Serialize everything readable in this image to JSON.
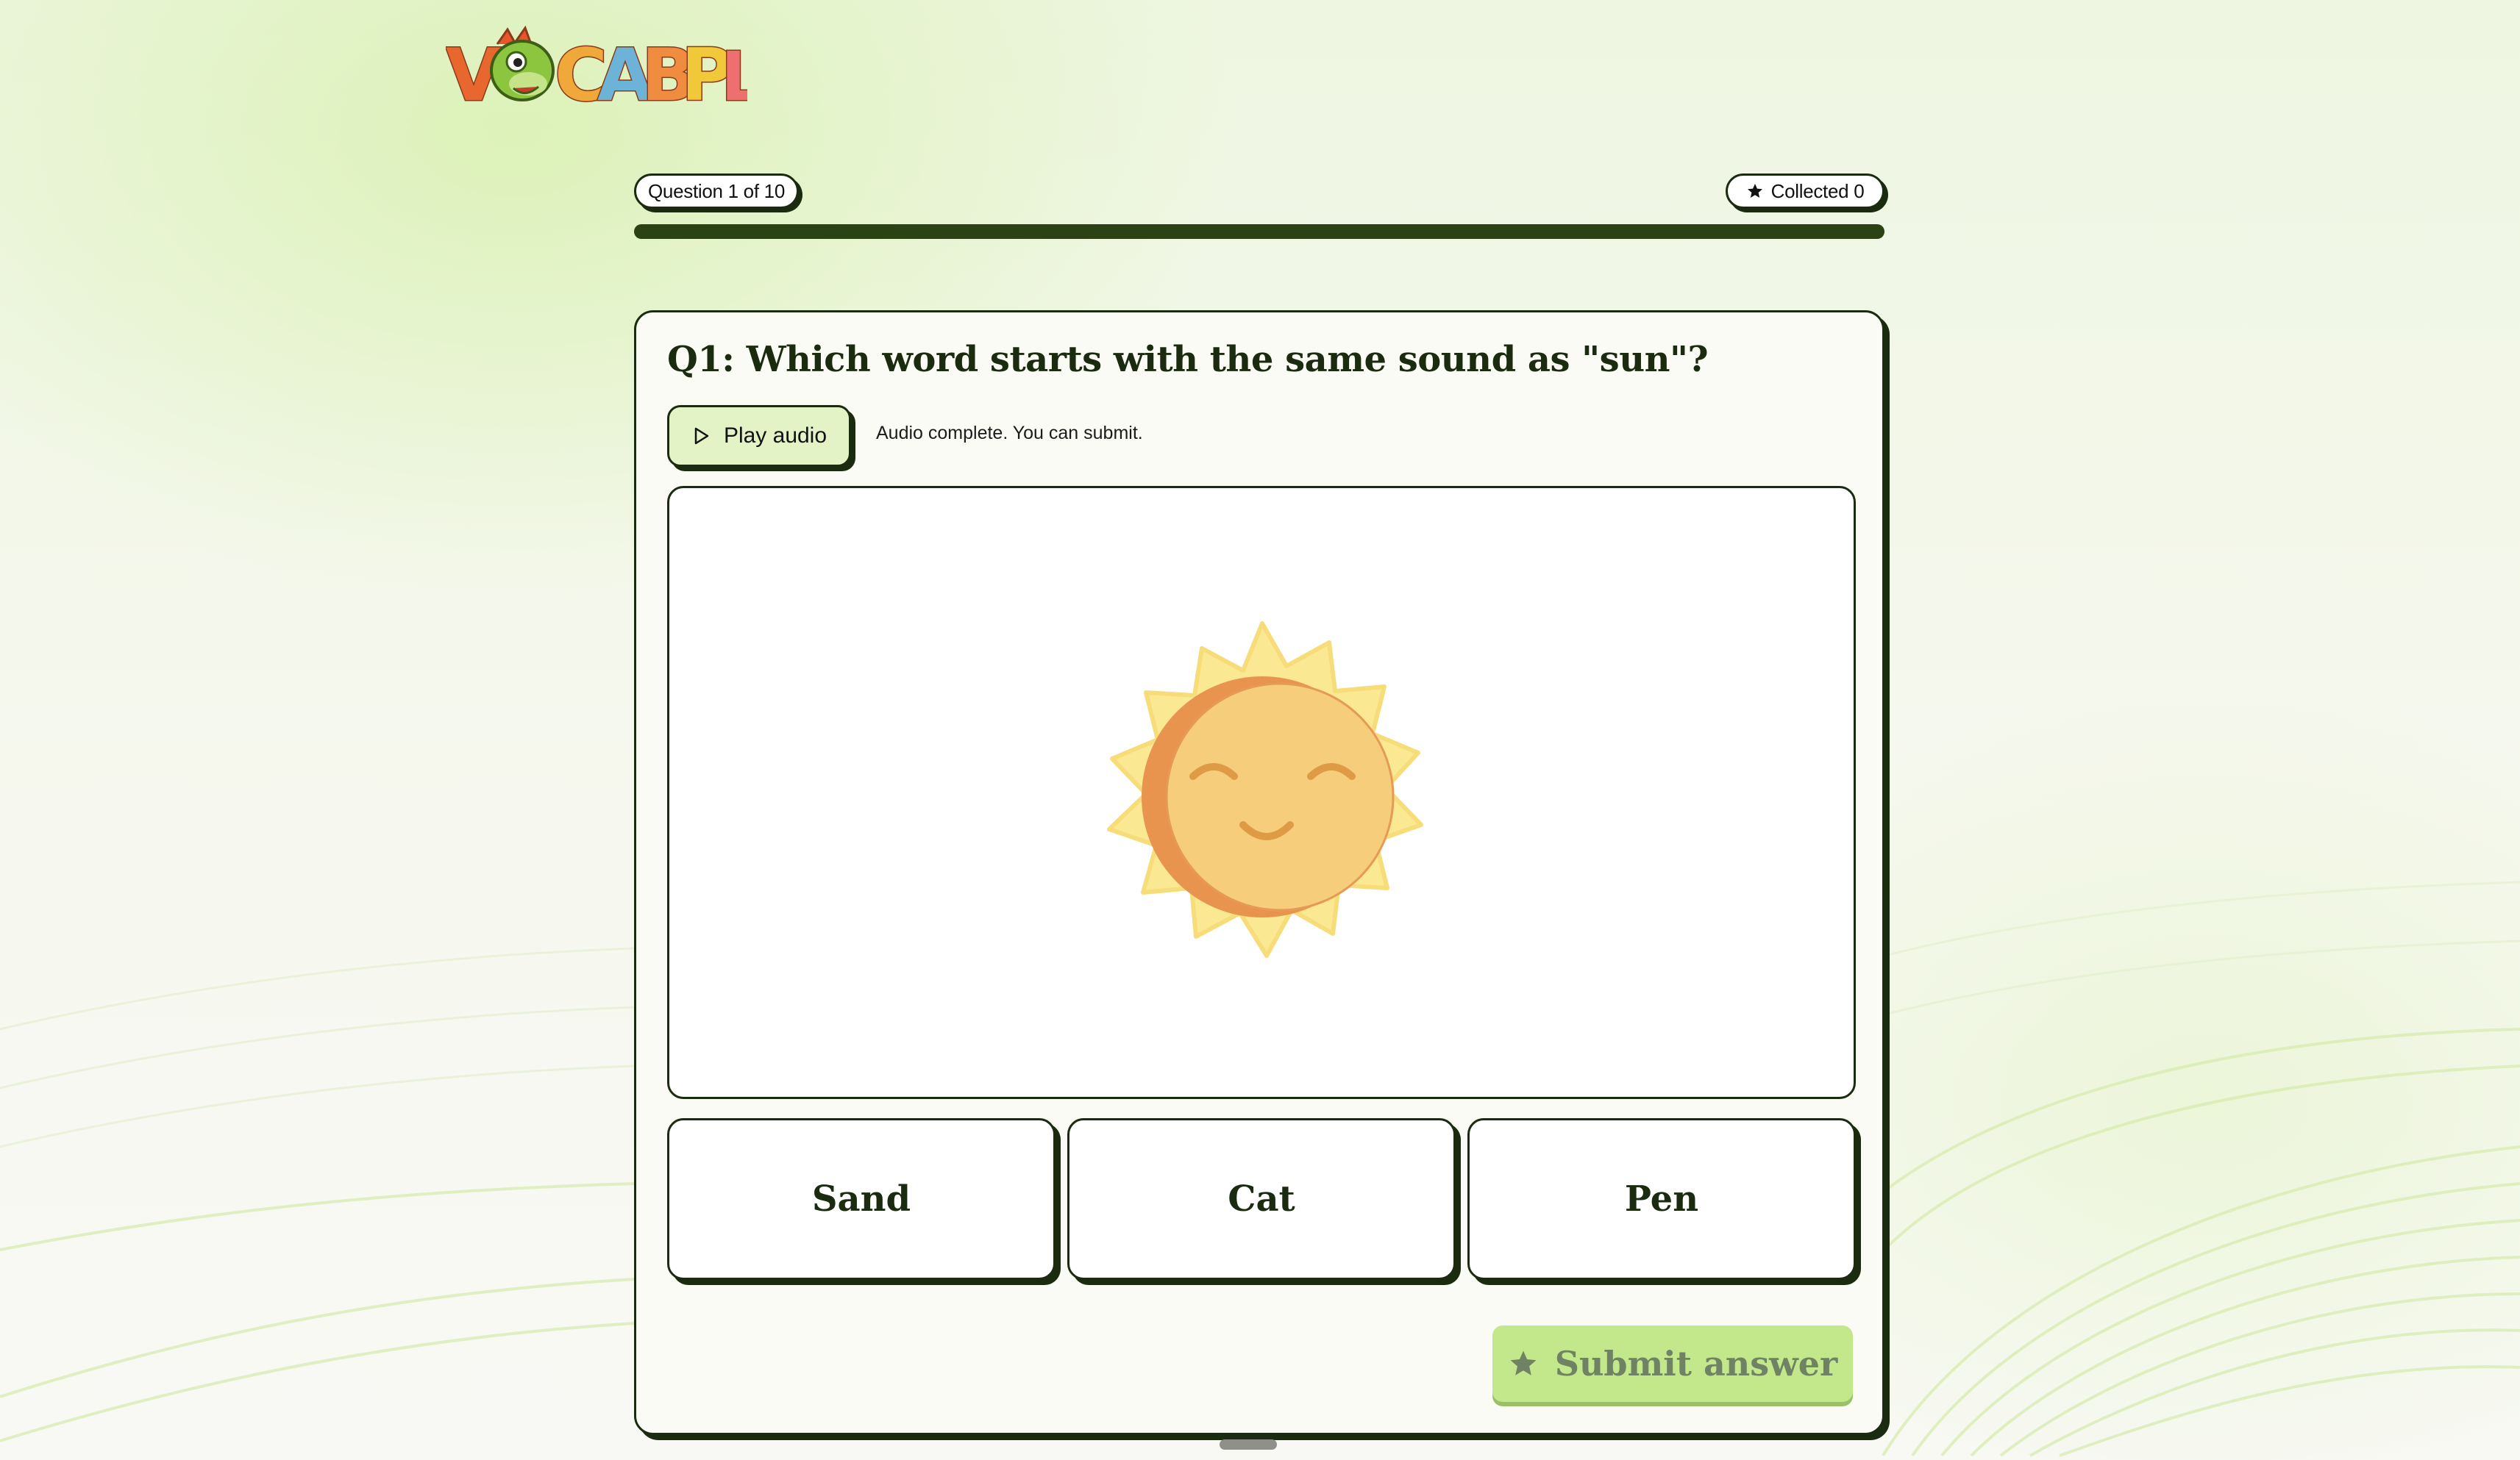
{
  "brand": {
    "logo_text": "VOCABPAL"
  },
  "header": {
    "question_counter": "Question 1 of 10",
    "collected_label": "Collected 0",
    "progress_fraction": 0.0
  },
  "question": {
    "title": "Q1: Which word starts with the same sound as \"sun\"?",
    "play_audio_label": "Play audio",
    "audio_status": "Audio complete. You can submit.",
    "image_subject": "sun-illustration"
  },
  "options": [
    {
      "label": "Sand"
    },
    {
      "label": "Cat"
    },
    {
      "label": "Pen"
    }
  ],
  "submit": {
    "label": "Submit answer",
    "enabled": false
  },
  "icons": {
    "collected": "star-icon",
    "play": "play-icon",
    "submit": "star-icon"
  },
  "colors": {
    "ink": "#1b2b10",
    "play_button_bg": "#e3f3c6",
    "submit_bg": "#c3e78b",
    "progress_track": "#2a4214"
  }
}
